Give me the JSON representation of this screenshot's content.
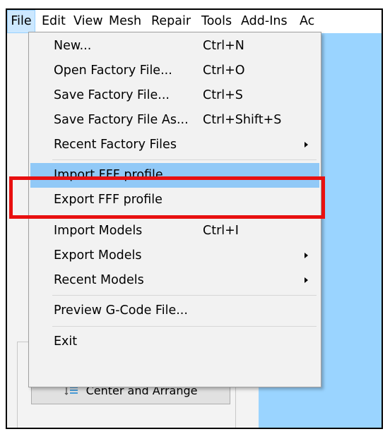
{
  "menubar": {
    "items": [
      "File",
      "Edit",
      "View",
      "Mesh",
      "Repair",
      "Tools",
      "Add-Ins",
      "Ac"
    ],
    "active_index": 0
  },
  "file_menu": {
    "items": [
      {
        "label": "New...",
        "shortcut": "Ctrl+N"
      },
      {
        "label": "Open Factory File...",
        "shortcut": "Ctrl+O"
      },
      {
        "label": "Save Factory File...",
        "shortcut": "Ctrl+S"
      },
      {
        "label": "Save Factory File As...",
        "shortcut": "Ctrl+Shift+S"
      },
      {
        "label": "Recent Factory Files",
        "shortcut": "",
        "submenu": true
      },
      {
        "label": "Import FFF profile",
        "shortcut": "",
        "highlighted": true
      },
      {
        "label": "Export FFF profile",
        "shortcut": ""
      },
      {
        "label": "Import Models",
        "shortcut": "Ctrl+I"
      },
      {
        "label": "Export Models",
        "shortcut": "",
        "submenu": true
      },
      {
        "label": "Recent Models",
        "shortcut": "",
        "submenu": true
      },
      {
        "label": "Preview G-Code File...",
        "shortcut": ""
      },
      {
        "label": "Exit",
        "shortcut": ""
      }
    ]
  },
  "left_panel": {
    "center_arrange_label": "Center and Arrange",
    "center_arrange_icon": "center-arrange-icon"
  },
  "colors": {
    "highlight": "#91c9f7",
    "callout": "#e81010",
    "viewport": "#9ad4ff"
  }
}
